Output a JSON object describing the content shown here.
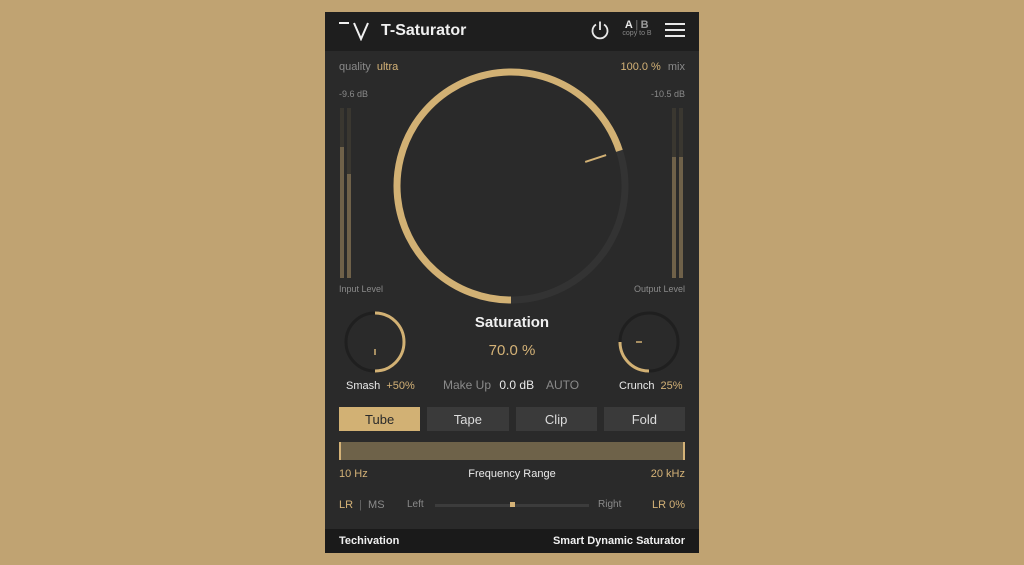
{
  "header": {
    "title": "T-Saturator",
    "ab": {
      "a": "A",
      "separator": "|",
      "b": "B",
      "copy": "copy to B"
    },
    "icons": {
      "logo": "techivation-logo",
      "power": "power-icon",
      "menu": "hamburger-menu-icon"
    }
  },
  "quality": {
    "label": "quality",
    "value": "ultra"
  },
  "mix": {
    "value": "100.0 %",
    "label": "mix"
  },
  "input": {
    "db": "-9.6 dB",
    "label": "Input Level",
    "level_left": 0.77,
    "level_right": 0.61
  },
  "output": {
    "db": "-10.5 dB",
    "label": "Output Level",
    "level_left": 0.71,
    "level_right": 0.71
  },
  "saturation": {
    "label": "Saturation",
    "value": "70.0 %",
    "amount": 0.7
  },
  "smash": {
    "label": "Smash",
    "value": "+50%",
    "amount": 0.5
  },
  "crunch": {
    "label": "Crunch",
    "value": "25%",
    "amount": 0.25
  },
  "makeup": {
    "label": "Make Up",
    "value": "0.0 dB",
    "auto": "AUTO"
  },
  "modes": [
    {
      "label": "Tube",
      "active": true
    },
    {
      "label": "Tape",
      "active": false
    },
    {
      "label": "Clip",
      "active": false
    },
    {
      "label": "Fold",
      "active": false
    }
  ],
  "frequency": {
    "low": "10 Hz",
    "label": "Frequency Range",
    "high": "20 kHz"
  },
  "stereo": {
    "lr": "LR",
    "separator": "|",
    "ms": "MS",
    "left": "Left",
    "right": "Right",
    "value": "LR 0%",
    "pan": 0.5
  },
  "footer": {
    "brand": "Techivation",
    "tagline": "Smart Dynamic Saturator"
  },
  "colors": {
    "accent": "#d4b277",
    "panel": "#2a2a2a",
    "background": "#c0a372"
  }
}
